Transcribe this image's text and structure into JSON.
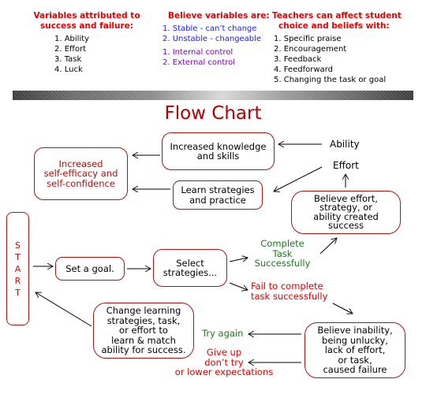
{
  "header": {
    "variables": {
      "title_line1": "Variables attributed to",
      "title_line2": "success and failure:",
      "items": [
        "1. Ability",
        "2. Effort",
        "3. Task",
        "4. Luck"
      ]
    },
    "beliefs": {
      "title": "Believe variables are:",
      "stability_items": [
        "1. Stable - can’t change",
        "2. Unstable - changeable"
      ],
      "control_items": [
        "1. Internal  control",
        "2. External control"
      ]
    },
    "teachers": {
      "title_line1": "Teachers can affect student",
      "title_line2": "choice and beliefs with:",
      "items": [
        "1. Specific praise",
        "2. Encouragement",
        "3. Feedback",
        "4. Feedforward",
        "5. Changing the task or goal"
      ]
    }
  },
  "flowchart": {
    "title": "Flow Chart",
    "start_letters": [
      "S",
      "T",
      "A",
      "R",
      "T"
    ],
    "nodes": {
      "increased_self_efficacy": [
        "Increased",
        "self-efficacy and",
        "self-confidence"
      ],
      "increased_knowledge": [
        "Increased knowledge",
        "and skills"
      ],
      "learn_strategies": [
        "Learn strategies",
        "and practice"
      ],
      "ability": "Ability",
      "effort": "Effort",
      "believe_effort": [
        "Believe effort,",
        "strategy, or",
        "ability created",
        "success"
      ],
      "set_goal": "Set a goal.",
      "select_strategies": [
        "Select",
        "strategies..."
      ],
      "complete_task": [
        "Complete",
        "Task",
        "Successfully"
      ],
      "fail_task": [
        "Fail to complete",
        "task successfully"
      ],
      "change_learning": [
        "Change learning",
        "strategies, task,",
        "or effort to",
        "learn & match",
        "ability for success."
      ],
      "try_again": "Try again",
      "give_up": [
        "Give up",
        "don’t try",
        "or lower expectations"
      ],
      "believe_inability": [
        "Believe inability,",
        "being unlucky,",
        "lack of effort,",
        "or task,",
        "caused failure"
      ]
    },
    "colors": {
      "box_border": "#a01818",
      "header_red": "#e60000",
      "title_red": "#b30000",
      "success_green": "#1d7a1d",
      "failure_red": "#e00000",
      "stable_blue": "#1a1aff",
      "control_purple": "#8000c0"
    }
  }
}
